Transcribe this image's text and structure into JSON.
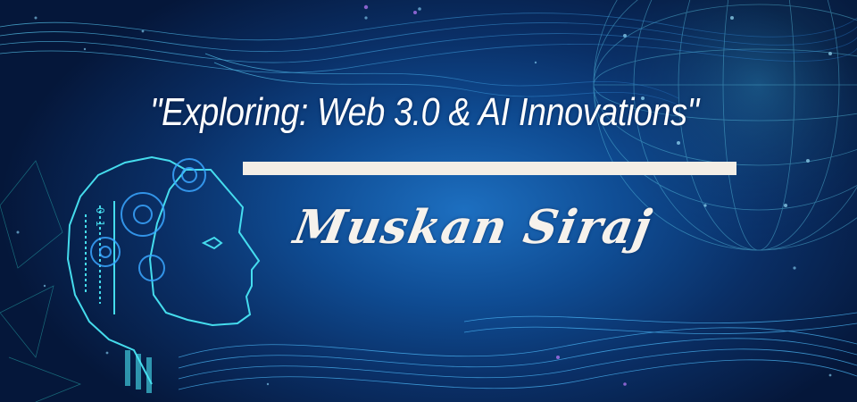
{
  "banner": {
    "headline": "\"Exploring: Web 3.0 & AI Innovations\"",
    "author": "Muskan Siraj",
    "colors": {
      "background_center": "#1d6fc0",
      "background_edge": "#05173a",
      "text": "#ffffff",
      "divider": "#f3eee6",
      "neon_cyan": "#49e6f5"
    },
    "icons": [
      "robot-head-icon",
      "gear-icon",
      "network-globe-icon",
      "particle-wave-icon"
    ]
  }
}
